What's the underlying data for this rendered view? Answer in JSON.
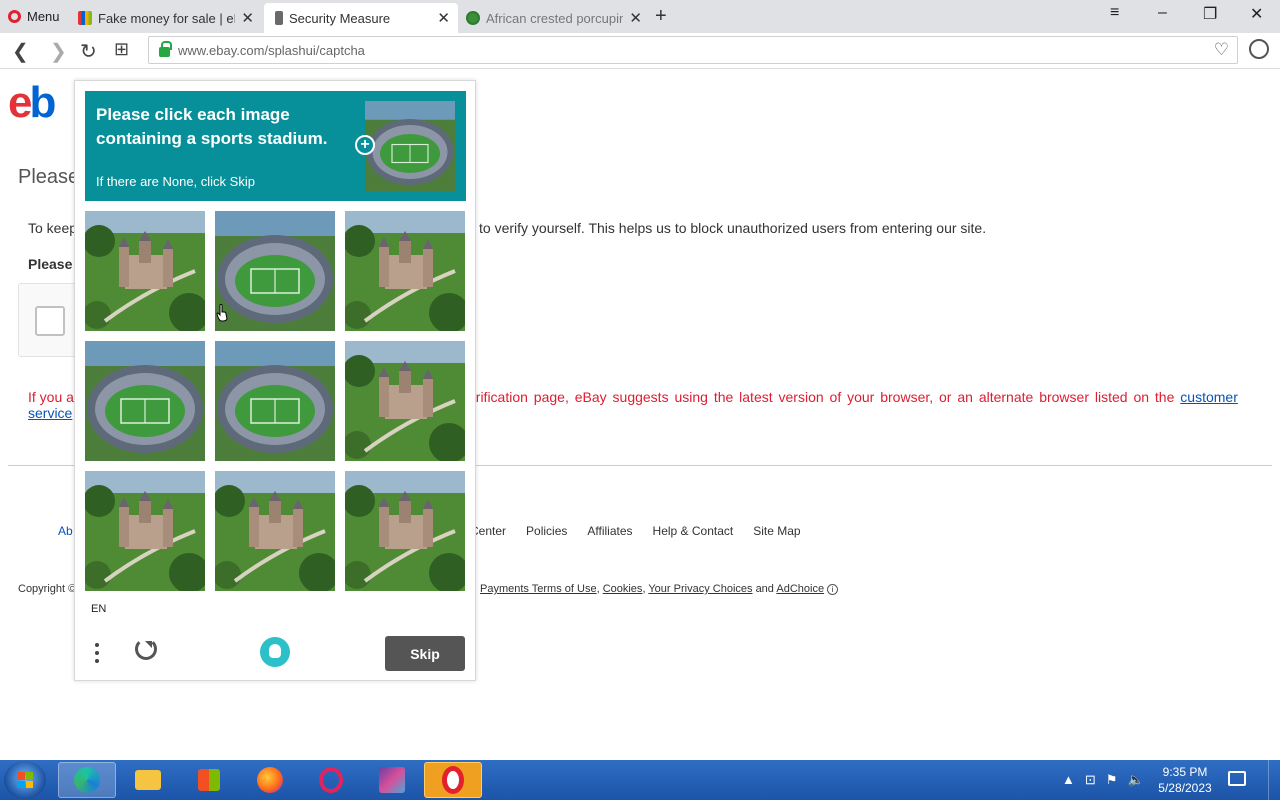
{
  "browser": {
    "menu_label": "Menu",
    "tabs": [
      {
        "label": "Fake money for sale | eBay",
        "favicon": "ebay-icon"
      },
      {
        "label": "Security Measure",
        "favicon": "lock-icon",
        "active": true
      },
      {
        "label": "African crested porcupine",
        "favicon": "globe-icon"
      }
    ],
    "url": "www.ebay.com/splashui/captcha"
  },
  "page": {
    "logo": {
      "part1": "e",
      "part2": "b"
    },
    "heading": "Please",
    "intro_left": "To keep",
    "intro_right": "to verify yourself. This helps us to block unauthorized users from entering our site.",
    "bold_label": "Please",
    "warning_left": "If you a",
    "warning_right": "erification page, eBay suggests using the latest version of your browser, or an alternate browser listed on the",
    "warning_link": "customer",
    "warning_link2": "service",
    "footer_about": "Ab",
    "footer_links": [
      "Center",
      "Policies",
      "Affiliates",
      "Help & Contact",
      "Site Map"
    ],
    "copyright": "Copyright ©",
    "legal": {
      "payments": "Payments Terms of Use",
      "cookies": "Cookies",
      "privacy": "Your Privacy Choices",
      "and": "and",
      "adchoice": "AdChoice"
    }
  },
  "captcha": {
    "title": "Please click each image containing a sports stadium.",
    "subtitle": "If there are None, click Skip",
    "language": "EN",
    "skip_label": "Skip",
    "images": [
      "castle",
      "stadium",
      "castle",
      "stadium",
      "stadium",
      "castle",
      "castle",
      "castle",
      "castle"
    ]
  },
  "taskbar": {
    "time": "9:35 PM",
    "date": "5/28/2023",
    "apps": [
      "edge-icon",
      "file-explorer-icon",
      "store-icon",
      "firefox-icon",
      "opera-gx-icon",
      "winrar-icon",
      "opera-icon"
    ]
  },
  "colors": {
    "captcha_header": "#08909a",
    "warning_text": "#dd1e31",
    "link": "#0654ba"
  }
}
